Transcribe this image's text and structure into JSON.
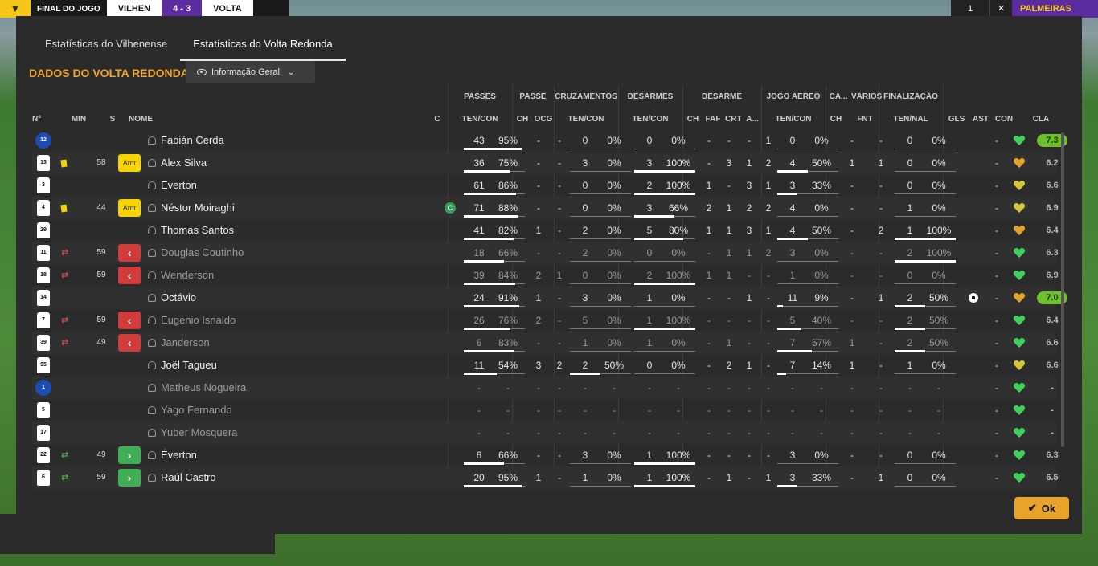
{
  "scoreboard": {
    "status": "FINAL DO JOGO",
    "home": "VILHEN",
    "score": "4 - 3",
    "away": "VOLTA",
    "right_a": "1",
    "right_c": "PALMEIRAS"
  },
  "tabs": [
    "Estatísticas do Vilhenense",
    "Estatísticas do Volta Redonda"
  ],
  "section_title": "DADOS DO VOLTA REDONDA",
  "dropdown_label": "Informação Geral",
  "ok_label": "Ok",
  "groups": [
    "PASSES",
    "PASSE",
    "CRUZAMENTOS",
    "DESARMES",
    "DESARME",
    "JOGO AÉREO",
    "CA...",
    "VÁRIOS",
    "FINALIZAÇÃO"
  ],
  "columns": [
    "Nº",
    "MIN",
    "S",
    "NOME",
    "C",
    "TEN/CON",
    "CH",
    "OCG",
    "TEN/CON",
    "TEN/CON",
    "CH",
    "FAF",
    "CRT",
    "A...",
    "TEN/CON",
    "CH",
    "FNT",
    "TEN/NAL",
    "GLS",
    "AST",
    "CON",
    "CLA"
  ],
  "colors": {
    "accent": "#f0a52a",
    "heart_green": "#3fd15a",
    "heart_yellow": "#d6c33a",
    "heart_orange": "#e0a12d",
    "rating_hi": "#6fbf2e"
  },
  "players": [
    {
      "num": "12",
      "gk": true,
      "min": "",
      "badge": "",
      "name": "Fabián Cerda",
      "dim": false,
      "c": "",
      "pass_a": "43",
      "pass_b": "95%",
      "pass_f": 0.95,
      "ch": "-",
      "ocg": "-",
      "cruz_a": "0",
      "cruz_b": "0%",
      "cruz_f": 0,
      "des_a": "0",
      "des_b": "0%",
      "des_f": 0,
      "d_ch": "-",
      "d_faf": "-",
      "d_crt": "-",
      "d_a": "1",
      "aer_a": "0",
      "aer_b": "0%",
      "aer_f": 0,
      "ca": "-",
      "fnt": "-",
      "fin_a": "0",
      "fin_b": "0%",
      "fin_f": 0,
      "gls": "",
      "ast": "-",
      "heart": "green",
      "cla": "7.3",
      "hi": true
    },
    {
      "num": "13",
      "gk": false,
      "min": "58",
      "badge": "amr",
      "icon": "card",
      "name": "Alex Silva",
      "dim": false,
      "c": "",
      "pass_a": "36",
      "pass_b": "75%",
      "pass_f": 0.75,
      "ch": "-",
      "ocg": "-",
      "cruz_a": "3",
      "cruz_b": "0%",
      "cruz_f": 0,
      "des_a": "3",
      "des_b": "100%",
      "des_f": 1,
      "d_ch": "-",
      "d_faf": "3",
      "d_crt": "1",
      "d_a": "2",
      "aer_a": "4",
      "aer_b": "50%",
      "aer_f": 0.5,
      "ca": "1",
      "fnt": "1",
      "fin_a": "0",
      "fin_b": "0%",
      "fin_f": 0,
      "gls": "",
      "ast": "-",
      "heart": "orange",
      "cla": "6.2",
      "hi": false
    },
    {
      "num": "3",
      "gk": false,
      "min": "",
      "badge": "",
      "name": "Everton",
      "dim": false,
      "c": "",
      "pass_a": "61",
      "pass_b": "86%",
      "pass_f": 0.86,
      "ch": "-",
      "ocg": "-",
      "cruz_a": "0",
      "cruz_b": "0%",
      "cruz_f": 0,
      "des_a": "2",
      "des_b": "100%",
      "des_f": 1,
      "d_ch": "1",
      "d_faf": "-",
      "d_crt": "3",
      "d_a": "1",
      "aer_a": "3",
      "aer_b": "33%",
      "aer_f": 0.33,
      "ca": "-",
      "fnt": "-",
      "fin_a": "0",
      "fin_b": "0%",
      "fin_f": 0,
      "gls": "",
      "ast": "-",
      "heart": "yellow",
      "cla": "6.6",
      "hi": false
    },
    {
      "num": "4",
      "gk": false,
      "min": "44",
      "badge": "amr",
      "icon": "card",
      "name": "Néstor Moiraghi",
      "dim": false,
      "c": "C",
      "pass_a": "71",
      "pass_b": "88%",
      "pass_f": 0.88,
      "ch": "-",
      "ocg": "-",
      "cruz_a": "0",
      "cruz_b": "0%",
      "cruz_f": 0,
      "des_a": "3",
      "des_b": "66%",
      "des_f": 0.66,
      "d_ch": "2",
      "d_faf": "1",
      "d_crt": "2",
      "d_a": "2",
      "aer_a": "4",
      "aer_b": "0%",
      "aer_f": 0,
      "ca": "-",
      "fnt": "-",
      "fin_a": "1",
      "fin_b": "0%",
      "fin_f": 0,
      "gls": "",
      "ast": "-",
      "heart": "yellow",
      "cla": "6.9",
      "hi": false
    },
    {
      "num": "29",
      "gk": false,
      "min": "",
      "badge": "",
      "name": "Thomas Santos",
      "dim": false,
      "c": "",
      "pass_a": "41",
      "pass_b": "82%",
      "pass_f": 0.82,
      "ch": "1",
      "ocg": "-",
      "cruz_a": "2",
      "cruz_b": "0%",
      "cruz_f": 0,
      "des_a": "5",
      "des_b": "80%",
      "des_f": 0.8,
      "d_ch": "1",
      "d_faf": "1",
      "d_crt": "3",
      "d_a": "1",
      "aer_a": "4",
      "aer_b": "50%",
      "aer_f": 0.5,
      "ca": "-",
      "fnt": "2",
      "fin_a": "1",
      "fin_b": "100%",
      "fin_f": 1,
      "gls": "",
      "ast": "-",
      "heart": "orange",
      "cla": "6.4",
      "hi": false
    },
    {
      "num": "11",
      "gk": false,
      "min": "59",
      "badge": "out",
      "icon": "out",
      "name": "Douglas Coutinho",
      "dim": true,
      "c": "",
      "pass_a": "18",
      "pass_b": "66%",
      "pass_f": 0.66,
      "ch": "-",
      "ocg": "-",
      "cruz_a": "2",
      "cruz_b": "0%",
      "cruz_f": 0,
      "des_a": "0",
      "des_b": "0%",
      "des_f": 0,
      "d_ch": "-",
      "d_faf": "1",
      "d_crt": "1",
      "d_a": "2",
      "aer_a": "3",
      "aer_b": "0%",
      "aer_f": 0,
      "ca": "-",
      "fnt": "-",
      "fin_a": "2",
      "fin_b": "100%",
      "fin_f": 1,
      "gls": "",
      "ast": "-",
      "heart": "green",
      "cla": "6.3",
      "hi": false
    },
    {
      "num": "18",
      "gk": false,
      "min": "59",
      "badge": "out",
      "icon": "out",
      "name": "Wenderson",
      "dim": true,
      "c": "",
      "pass_a": "39",
      "pass_b": "84%",
      "pass_f": 0.84,
      "ch": "2",
      "ocg": "1",
      "cruz_a": "0",
      "cruz_b": "0%",
      "cruz_f": 0,
      "des_a": "2",
      "des_b": "100%",
      "des_f": 1,
      "d_ch": "1",
      "d_faf": "1",
      "d_crt": "-",
      "d_a": "-",
      "aer_a": "1",
      "aer_b": "0%",
      "aer_f": 0,
      "ca": "-",
      "fnt": "-",
      "fin_a": "0",
      "fin_b": "0%",
      "fin_f": 0,
      "gls": "",
      "ast": "-",
      "heart": "green",
      "cla": "6.9",
      "hi": false
    },
    {
      "num": "14",
      "gk": false,
      "min": "",
      "badge": "",
      "name": "Octávio",
      "dim": false,
      "c": "",
      "pass_a": "24",
      "pass_b": "91%",
      "pass_f": 0.91,
      "ch": "1",
      "ocg": "-",
      "cruz_a": "3",
      "cruz_b": "0%",
      "cruz_f": 0,
      "des_a": "1",
      "des_b": "0%",
      "des_f": 0,
      "d_ch": "-",
      "d_faf": "-",
      "d_crt": "1",
      "d_a": "-",
      "aer_a": "11",
      "aer_b": "9%",
      "aer_f": 0.09,
      "ca": "-",
      "fnt": "1",
      "fin_a": "2",
      "fin_b": "50%",
      "fin_f": 0.5,
      "gls": "ball",
      "ast": "-",
      "heart": "orange",
      "cla": "7.0",
      "hi": true
    },
    {
      "num": "7",
      "gk": false,
      "min": "59",
      "badge": "out",
      "icon": "out",
      "name": "Eugenio Isnaldo",
      "dim": true,
      "c": "",
      "pass_a": "26",
      "pass_b": "76%",
      "pass_f": 0.76,
      "ch": "2",
      "ocg": "-",
      "cruz_a": "5",
      "cruz_b": "0%",
      "cruz_f": 0,
      "des_a": "1",
      "des_b": "100%",
      "des_f": 1,
      "d_ch": "-",
      "d_faf": "-",
      "d_crt": "-",
      "d_a": "-",
      "aer_a": "5",
      "aer_b": "40%",
      "aer_f": 0.4,
      "ca": "-",
      "fnt": "-",
      "fin_a": "2",
      "fin_b": "50%",
      "fin_f": 0.5,
      "gls": "",
      "ast": "-",
      "heart": "green",
      "cla": "6.4",
      "hi": false
    },
    {
      "num": "39",
      "gk": false,
      "min": "49",
      "badge": "out",
      "icon": "out",
      "name": "Janderson",
      "dim": true,
      "c": "",
      "pass_a": "6",
      "pass_b": "83%",
      "pass_f": 0.83,
      "ch": "-",
      "ocg": "-",
      "cruz_a": "1",
      "cruz_b": "0%",
      "cruz_f": 0,
      "des_a": "1",
      "des_b": "0%",
      "des_f": 0,
      "d_ch": "-",
      "d_faf": "1",
      "d_crt": "-",
      "d_a": "-",
      "aer_a": "7",
      "aer_b": "57%",
      "aer_f": 0.57,
      "ca": "1",
      "fnt": "-",
      "fin_a": "2",
      "fin_b": "50%",
      "fin_f": 0.5,
      "gls": "",
      "ast": "-",
      "heart": "green",
      "cla": "6.6",
      "hi": false
    },
    {
      "num": "95",
      "gk": false,
      "min": "",
      "badge": "",
      "name": "Joël Tagueu",
      "dim": false,
      "c": "",
      "pass_a": "11",
      "pass_b": "54%",
      "pass_f": 0.54,
      "ch": "3",
      "ocg": "2",
      "cruz_a": "2",
      "cruz_b": "50%",
      "cruz_f": 0.5,
      "des_a": "0",
      "des_b": "0%",
      "des_f": 0,
      "d_ch": "-",
      "d_faf": "2",
      "d_crt": "1",
      "d_a": "-",
      "aer_a": "7",
      "aer_b": "14%",
      "aer_f": 0.14,
      "ca": "1",
      "fnt": "-",
      "fin_a": "1",
      "fin_b": "0%",
      "fin_f": 0,
      "gls": "",
      "ast": "-",
      "heart": "yellow",
      "cla": "6.6",
      "hi": false
    },
    {
      "num": "1",
      "gk": true,
      "min": "",
      "badge": "",
      "name": "Matheus Nogueira",
      "dim": true,
      "c": "",
      "pass_a": "-",
      "pass_b": "-",
      "pass_f": 0,
      "ch": "-",
      "ocg": "-",
      "cruz_a": "-",
      "cruz_b": "-",
      "cruz_f": 0,
      "des_a": "-",
      "des_b": "-",
      "des_f": 0,
      "d_ch": "-",
      "d_faf": "-",
      "d_crt": "-",
      "d_a": "-",
      "aer_a": "-",
      "aer_b": "-",
      "aer_f": 0,
      "ca": "-",
      "fnt": "-",
      "fin_a": "-",
      "fin_b": "-",
      "fin_f": 0,
      "gls": "",
      "ast": "-",
      "heart": "green",
      "cla": "-",
      "hi": false
    },
    {
      "num": "5",
      "gk": false,
      "min": "",
      "badge": "",
      "name": "Yago Fernando",
      "dim": true,
      "c": "",
      "pass_a": "-",
      "pass_b": "-",
      "pass_f": 0,
      "ch": "-",
      "ocg": "-",
      "cruz_a": "-",
      "cruz_b": "-",
      "cruz_f": 0,
      "des_a": "-",
      "des_b": "-",
      "des_f": 0,
      "d_ch": "-",
      "d_faf": "-",
      "d_crt": "-",
      "d_a": "-",
      "aer_a": "-",
      "aer_b": "-",
      "aer_f": 0,
      "ca": "-",
      "fnt": "-",
      "fin_a": "-",
      "fin_b": "-",
      "fin_f": 0,
      "gls": "",
      "ast": "-",
      "heart": "green",
      "cla": "-",
      "hi": false
    },
    {
      "num": "17",
      "gk": false,
      "min": "",
      "badge": "",
      "name": "Yuber Mosquera",
      "dim": true,
      "c": "",
      "pass_a": "-",
      "pass_b": "-",
      "pass_f": 0,
      "ch": "-",
      "ocg": "-",
      "cruz_a": "-",
      "cruz_b": "-",
      "cruz_f": 0,
      "des_a": "-",
      "des_b": "-",
      "des_f": 0,
      "d_ch": "-",
      "d_faf": "-",
      "d_crt": "-",
      "d_a": "-",
      "aer_a": "-",
      "aer_b": "-",
      "aer_f": 0,
      "ca": "-",
      "fnt": "-",
      "fin_a": "-",
      "fin_b": "-",
      "fin_f": 0,
      "gls": "",
      "ast": "-",
      "heart": "green",
      "cla": "-",
      "hi": false
    },
    {
      "num": "22",
      "gk": false,
      "min": "49",
      "badge": "in",
      "icon": "in",
      "name": "Éverton",
      "dim": false,
      "c": "",
      "pass_a": "6",
      "pass_b": "66%",
      "pass_f": 0.66,
      "ch": "-",
      "ocg": "-",
      "cruz_a": "3",
      "cruz_b": "0%",
      "cruz_f": 0,
      "des_a": "1",
      "des_b": "100%",
      "des_f": 1,
      "d_ch": "-",
      "d_faf": "-",
      "d_crt": "-",
      "d_a": "-",
      "aer_a": "3",
      "aer_b": "0%",
      "aer_f": 0,
      "ca": "-",
      "fnt": "-",
      "fin_a": "0",
      "fin_b": "0%",
      "fin_f": 0,
      "gls": "",
      "ast": "-",
      "heart": "green",
      "cla": "6.3",
      "hi": false
    },
    {
      "num": "6",
      "gk": false,
      "min": "59",
      "badge": "in",
      "icon": "in",
      "name": "Raúl Castro",
      "dim": false,
      "c": "",
      "pass_a": "20",
      "pass_b": "95%",
      "pass_f": 0.95,
      "ch": "1",
      "ocg": "-",
      "cruz_a": "1",
      "cruz_b": "0%",
      "cruz_f": 0,
      "des_a": "1",
      "des_b": "100%",
      "des_f": 1,
      "d_ch": "-",
      "d_faf": "1",
      "d_crt": "-",
      "d_a": "1",
      "aer_a": "3",
      "aer_b": "33%",
      "aer_f": 0.33,
      "ca": "-",
      "fnt": "1",
      "fin_a": "0",
      "fin_b": "0%",
      "fin_f": 0,
      "gls": "",
      "ast": "-",
      "heart": "green",
      "cla": "6.5",
      "hi": false
    }
  ],
  "badge_labels": {
    "amr": "Amr",
    "out": "‹",
    "in": "›"
  }
}
